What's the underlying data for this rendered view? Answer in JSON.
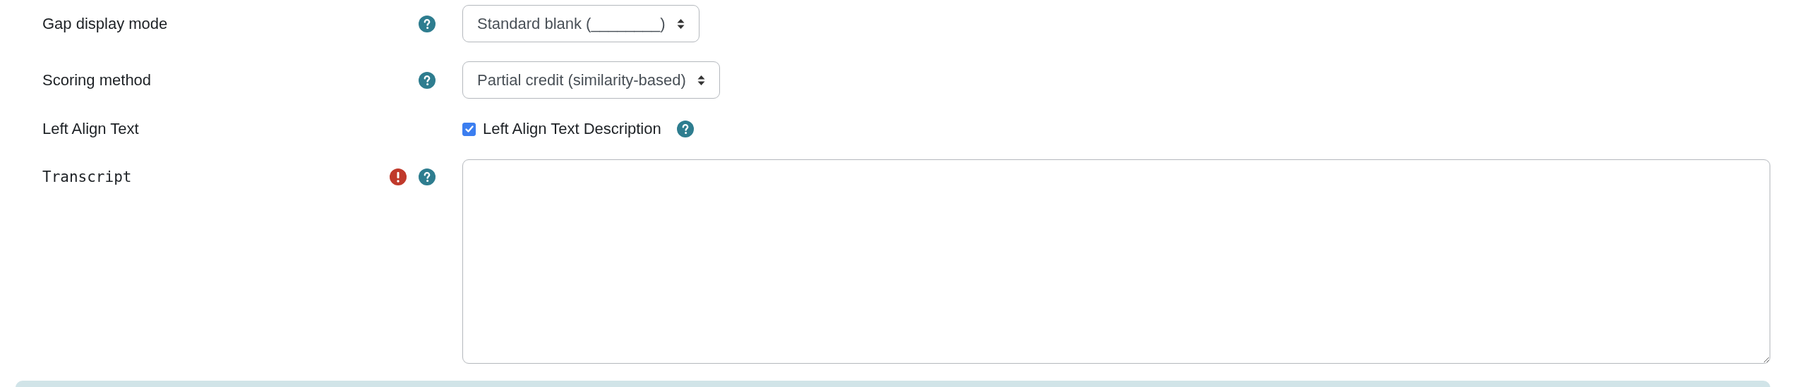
{
  "fields": [
    {
      "kind": "select",
      "label": "Gap display mode",
      "help": true,
      "value": "Standard blank (________)"
    },
    {
      "kind": "select",
      "label": "Scoring method",
      "help": true,
      "value": "Partial credit (similarity-based)"
    },
    {
      "kind": "checkbox",
      "label": "Left Align Text",
      "help": false,
      "option": {
        "label": "Left Align Text Description",
        "checked": true,
        "help": true
      }
    },
    {
      "kind": "textarea",
      "label": "Transcript",
      "required": true,
      "help": true
    }
  ],
  "footer_panel": {
    "kind": "info"
  }
}
